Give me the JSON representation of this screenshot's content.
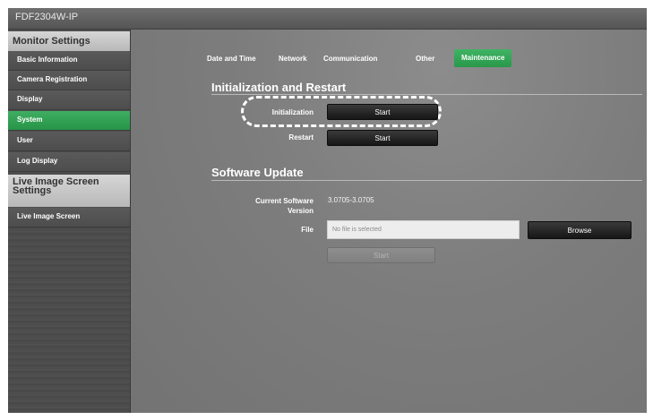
{
  "app": {
    "title": "FDF2304W-IP"
  },
  "sidebar": {
    "section1": "Monitor Settings",
    "items": [
      {
        "label": "Basic Information"
      },
      {
        "label": "Camera Registration"
      },
      {
        "label": "Display"
      },
      {
        "label": "System"
      },
      {
        "label": "User"
      },
      {
        "label": "Log Display"
      }
    ],
    "section2": "Live Image Screen Settings",
    "items2": [
      {
        "label": "Live Image Screen"
      }
    ]
  },
  "tabs": [
    {
      "label": "Date and Time"
    },
    {
      "label": "Network"
    },
    {
      "label": "Communication"
    },
    {
      "label": "Other"
    },
    {
      "label": "Maintenance"
    }
  ],
  "sections": {
    "init": {
      "title": "Initialization and Restart",
      "initialization_label": "Initialization",
      "initialization_button": "Start",
      "restart_label": "Restart",
      "restart_button": "Start"
    },
    "update": {
      "title": "Software Update",
      "current_label_line1": "Current Software",
      "current_label_line2": "Version",
      "current_value": "3.0705-3.0705",
      "file_label": "File",
      "file_placeholder": "No file is selected",
      "browse_button": "Browse",
      "start_button": "Start"
    }
  },
  "colors": {
    "accent_green": "#2ea052",
    "background": "#7b7b7b"
  }
}
